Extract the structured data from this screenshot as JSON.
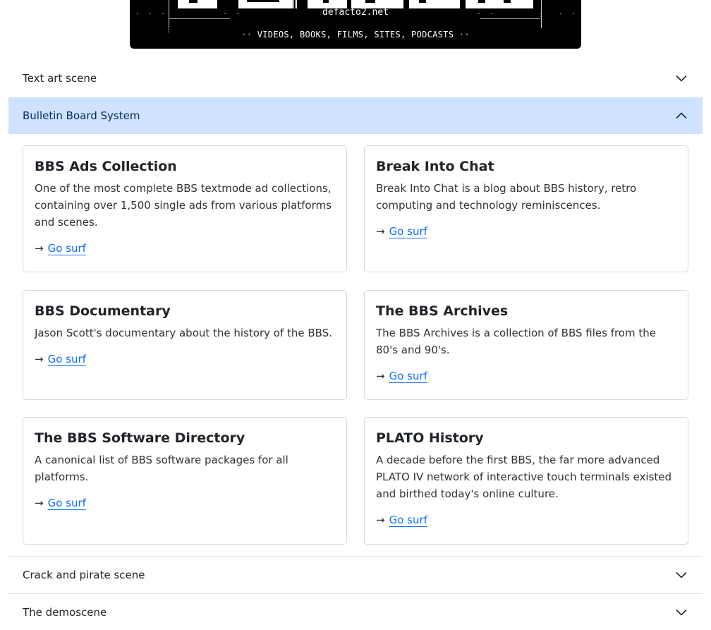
{
  "banner": {
    "site": "defacto2.net",
    "tagline": [
      "VIDEOS",
      "BOOKS",
      "FILMS",
      "SITES",
      "PODCASTS"
    ]
  },
  "sections": {
    "text_art": {
      "label": "Text art scene"
    },
    "bbs": {
      "label": "Bulletin Board System"
    },
    "crack": {
      "label": "Crack and pirate scene"
    },
    "demoscene": {
      "label": "The demoscene"
    }
  },
  "cards": [
    {
      "title": "BBS Ads Collection",
      "description": "One of the most complete BBS textmode ad collections, containing over 1,500 single ads from various platforms and scenes.",
      "link_label": "Go surf"
    },
    {
      "title": "Break Into Chat",
      "description": "Break Into Chat is a blog about BBS history, retro computing and technology reminiscences.",
      "link_label": "Go surf"
    },
    {
      "title": "BBS Documentary",
      "description": "Jason Scott's documentary about the history of the BBS.",
      "link_label": "Go surf"
    },
    {
      "title": "The BBS Archives",
      "description": "The BBS Archives is a collection of BBS files from the 80's and 90's.",
      "link_label": "Go surf"
    },
    {
      "title": "The BBS Software Directory",
      "description": "A canonical list of BBS software packages for all platforms.",
      "link_label": "Go surf"
    },
    {
      "title": "PLATO History",
      "description": "A decade before the first BBS, the far more advanced PLATO IV network of interactive touch terminals existed and birthed today's online culture.",
      "link_label": "Go surf"
    }
  ],
  "colors": {
    "accent": "#cfe2ff",
    "accent_text": "#052c65",
    "link": "#0d6efd"
  },
  "icons": {
    "arrow": "right-arrow-icon",
    "expand": "chevron-down-icon",
    "collapse": "chevron-up-icon"
  }
}
